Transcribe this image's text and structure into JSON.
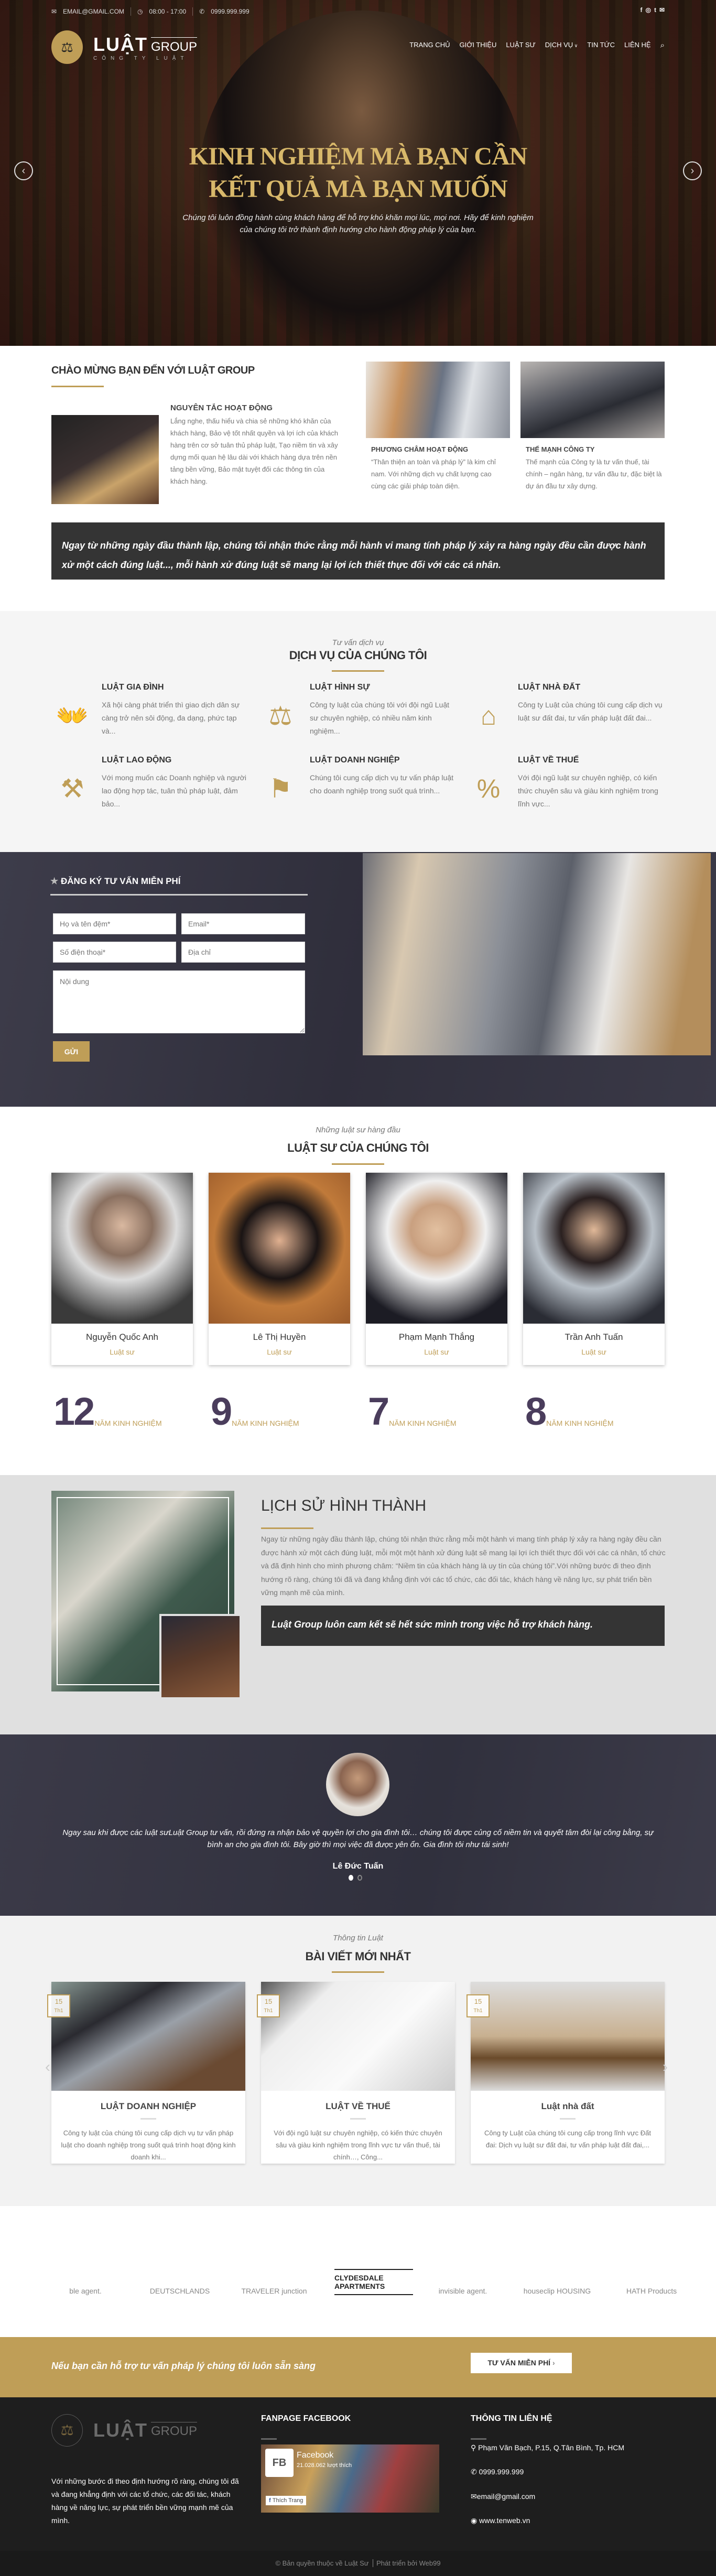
{
  "topbar": {
    "email": "EMAIL@GMAIL.COM",
    "hours": "08:00 - 17:00",
    "phone": "0999.999.999",
    "social": [
      "f",
      "ig",
      "tw",
      "mail"
    ]
  },
  "logo": {
    "main": "LUẬT",
    "group": "GROUP",
    "tagline": "CÔNG TY LUẬT"
  },
  "nav": [
    {
      "label": "TRANG CHỦ"
    },
    {
      "label": "GIỚI THIỆU"
    },
    {
      "label": "LUẬT SƯ"
    },
    {
      "label": "DỊCH VỤ"
    },
    {
      "label": "TIN TỨC"
    },
    {
      "label": "LIÊN HỆ"
    }
  ],
  "hero": {
    "title1": "KINH NGHIỆM MÀ BẠN CẦN",
    "title2": "KẾT QUẢ MÀ BẠN MUỐN",
    "sub1": "Chúng tôi luôn đồng hành cùng khách hàng để hỗ trợ khó khăn mọi lúc, mọi nơi. Hãy để kinh nghiệm",
    "sub2": "của chúng tôi trở thành định hướng cho hành động pháp lý của bạn.",
    "prev": "‹",
    "next": "›"
  },
  "welcome": {
    "heading": "CHÀO MỪNG BẠN ĐẾN VỚI LUẬT GROUP",
    "principle": {
      "title": "NGUYÊN TẮC HOẠT ĐỘNG",
      "text": "Lắng nghe, thấu hiểu và chia sẻ những khó khăn của khách hàng, Bảo vệ tốt nhất quyền và lợi ích của khách hàng trên cơ sở tuân thủ pháp luật, Tạo niềm tin và xây dựng mối quan hệ lâu dài với khách hàng dựa trên nền tảng bền vững, Bảo mật tuyệt đối các thông tin của khách hàng."
    },
    "motto": {
      "title": "PHƯƠNG CHÂM HOẠT ĐỘNG",
      "text": "“Thân thiện an toàn và pháp lý” là kim chỉ nam. Với những dịch vụ chất lượng cao cùng các giải pháp toàn diện."
    },
    "strength": {
      "title": "THẾ MẠNH CÔNG TY",
      "text": "Thế mạnh của Công ty là tư vấn thuế, tài chính – ngân hàng, tư vấn đầu tư, đặc biệt là dự án đầu tư xây dựng."
    },
    "quote": "Ngay từ những ngày đầu thành lập, chúng tôi nhận thức rằng mỗi hành vi mang tính pháp lý xảy ra hàng ngày đều cần được hành xử một cách đúng luật..., mỗi hành xử đúng luật sẽ mang lại lợi ích thiết thực đối với các cá nhân."
  },
  "services": {
    "subtitle": "Tư vấn dịch vụ",
    "title": "DỊCH VỤ CỦA CHÚNG TÔI",
    "items": [
      {
        "title": "LUẬT GIA ĐÌNH",
        "text": "Xã hội càng phát triển thì giao dịch dân sự càng trở nên sôi động, đa dạng, phức tạp và...",
        "icon": "family-hands-icon"
      },
      {
        "title": "LUẬT HÌNH SỰ",
        "text": "Công ty luật của chúng tôi với đội ngũ Luật sư chuyên nghiệp, có nhiều năm kinh nghiệm...",
        "icon": "scales-icon"
      },
      {
        "title": "LUẬT NHÀ ĐẤT",
        "text": "Công ty Luật của chúng tôi cung cấp dịch vụ luật sư đất đai, tư vấn pháp luật đất đai...",
        "icon": "house-icon"
      },
      {
        "title": "LUẬT LAO ĐỘNG",
        "text": "Với mong muốn các Doanh nghiệp và người lao động hợp tác, tuân thủ pháp luật, đảm bảo...",
        "icon": "worker-icon"
      },
      {
        "title": "LUẬT DOANH NGHIỆP",
        "text": "Chúng tôi cung cấp dịch vụ tư vấn pháp luật cho doanh nghiệp trong suốt quá trình...",
        "icon": "gavel-icon"
      },
      {
        "title": "LUẬT VỀ THUẾ",
        "text": "Với đội ngũ luật sư chuyên nghiệp, có kiến thức chuyên sâu và giàu kinh nghiệm trong lĩnh vực...",
        "icon": "tax-document-icon"
      }
    ]
  },
  "form": {
    "title": "ĐĂNG KÝ TƯ VẤN MIỄN PHÍ",
    "name": "Họ và tên đệm*",
    "email": "Email*",
    "phone": "Số điện thoại*",
    "address": "Địa chỉ",
    "content": "Nội dung",
    "submit": "GỬI"
  },
  "lawyers": {
    "subtitle": "Những luật sư hàng đầu",
    "title": "LUẬT SƯ CỦA CHÚNG TÔI",
    "items": [
      {
        "name": "Nguyễn Quốc Anh",
        "role": "Luật sư"
      },
      {
        "name": "Lê Thị Huyền",
        "role": "Luật sư"
      },
      {
        "name": "Phạm Mạnh Thắng",
        "role": "Luật sư"
      },
      {
        "name": "Trần Anh Tuấn",
        "role": "Luật sư"
      }
    ],
    "stats": [
      {
        "n": "12",
        "label": "NĂM KINH NGHIỆM"
      },
      {
        "n": "9",
        "label": "NĂM KINH NGHIỆM"
      },
      {
        "n": "7",
        "label": "NĂM KINH NGHIỆM"
      },
      {
        "n": "8",
        "label": "NĂM KINH NGHIỆM"
      }
    ]
  },
  "history": {
    "title": "LỊCH SỬ HÌNH THÀNH",
    "text": "Ngay từ những ngày đầu thành lập, chúng tôi nhận thức rằng mỗi một hành vi mang tính pháp lý xảy ra hàng ngày đều cần được hành xử một cách đúng luật, mỗi một một hành xử đúng luật sẽ mang lại lợi ích thiết thực đối với các cá nhân, tổ chức và đã định hình cho mình phương châm: “Niềm tin của khách hàng là uy tín của chúng tôi”.Với những bước đi theo định hướng rõ ràng, chúng tôi đã và đang khẳng định với các tổ chức, các đối tác, khách hàng về năng lực, sự phát triển bền vững mạnh mẽ của mình.",
    "quote": "Luật Group luôn cam kết sẽ hết sức mình trong việc hỗ trợ khách hàng."
  },
  "testimonial": {
    "text": "Ngay sau khi được các luật sưLuật Group tư vấn, rồi đứng ra nhận bảo vệ quyền lợi cho gia đình tôi… chúng tôi được củng cố niềm tin và quyết tâm đòi lại công bằng, sự bình an cho gia đình tôi. Bây giờ thì mọi việc đã được yên ổn. Gia đình tôi như tái sinh!",
    "name": "Lê Đức Tuấn",
    "slides": 2,
    "active": 1
  },
  "blog": {
    "subtitle": "Thông tin Luật",
    "title": "BÀI VIẾT MỚI NHẤT",
    "posts": [
      {
        "day": "15",
        "month": "Th1",
        "title": "LUẬT DOANH NGHIỆP",
        "text": "Công ty luật của chúng tôi cung cấp dịch vụ tư vấn pháp luật cho doanh nghiệp trong suốt quá trình hoạt động kinh doanh khi..."
      },
      {
        "day": "15",
        "month": "Th1",
        "title": "LUẬT VỀ THUẾ",
        "text": "Với đội ngũ luật sư chuyên nghiệp, có kiến thức chuyên sâu và giàu kinh nghiệm trong lĩnh vực tư vấn thuế, tài chính…, Công..."
      },
      {
        "day": "15",
        "month": "Th1",
        "title": "Luật nhà đất",
        "text": "Công ty Luật của chúng tôi cung cấp trong lĩnh vực Đất đai: Dịch vụ luật sư đất đai, tư vấn pháp luật đất đai,..."
      }
    ]
  },
  "partners": [
    "ble agent.",
    "DEUTSCHLANDS",
    "TRAVELER junction",
    "CLYDESDALE APARTMENTS",
    "invisible agent.",
    "houseclip HOUSING",
    "HATH Products"
  ],
  "cta": {
    "text": "Nếu bạn cần hỗ trợ tư vấn pháp lý chúng tôi luôn sẵn sàng",
    "button": "TƯ VẤN MIỄN PHÍ"
  },
  "footer": {
    "about": "Với những bước đi theo định hướng rõ ràng, chúng tôi đã và đang khẳng định với các tổ chức, các đối tác, khách hàng về năng lực, sự phát triển bền vững mạnh mẽ của mình.",
    "fb_title": "FANPAGE FACEBOOK",
    "fb_name": "Facebook",
    "fb_likes": "21.028.062 lượt thích",
    "fb_like_btn": "Thích Trang",
    "contact_title": "THÔNG TIN LIÊN HỆ",
    "address": "Phạm Văn Bạch, P.15, Q.Tân Bình, Tp. HCM",
    "phone": "0999.999.999",
    "email": "email@gmail.com",
    "web": "www.tenweb.vn",
    "copyright": "© Bản quyền thuộc về Luật Sư",
    "dev": "Phát triển bởi Web99"
  },
  "colors": {
    "gold": "#bf9e57",
    "dark": "#343434",
    "navy": "#3a3947"
  }
}
